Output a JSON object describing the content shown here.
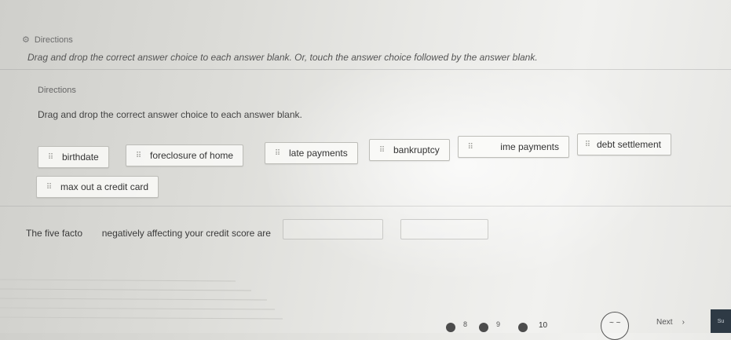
{
  "outer": {
    "header": "Directions",
    "instruction": "Drag and drop the correct answer choice to each answer blank. Or, touch the answer choice followed by the answer blank."
  },
  "inner": {
    "header": "Directions",
    "instruction": "Drag and drop the correct answer choice to each answer blank."
  },
  "choices": [
    {
      "label": "birthdate"
    },
    {
      "label": "foreclosure of home"
    },
    {
      "label": "late payments"
    },
    {
      "label": "bankruptcy"
    },
    {
      "label": "ime payments"
    },
    {
      "label": "debt settlement"
    },
    {
      "label": "max out a credit card"
    }
  ],
  "prompt": {
    "text_start": "The five facto",
    "text_end": "negatively affecting your credit score are"
  },
  "progress": {
    "labels": [
      "8",
      "9"
    ],
    "current": "10"
  },
  "nav": {
    "prev_symbol": "~ ~",
    "next_label": "Next",
    "next_symbol": "›",
    "submit_label": "Su"
  },
  "colors": {
    "background": "#e6e6e3",
    "submit_bg": "#2e3a45"
  }
}
